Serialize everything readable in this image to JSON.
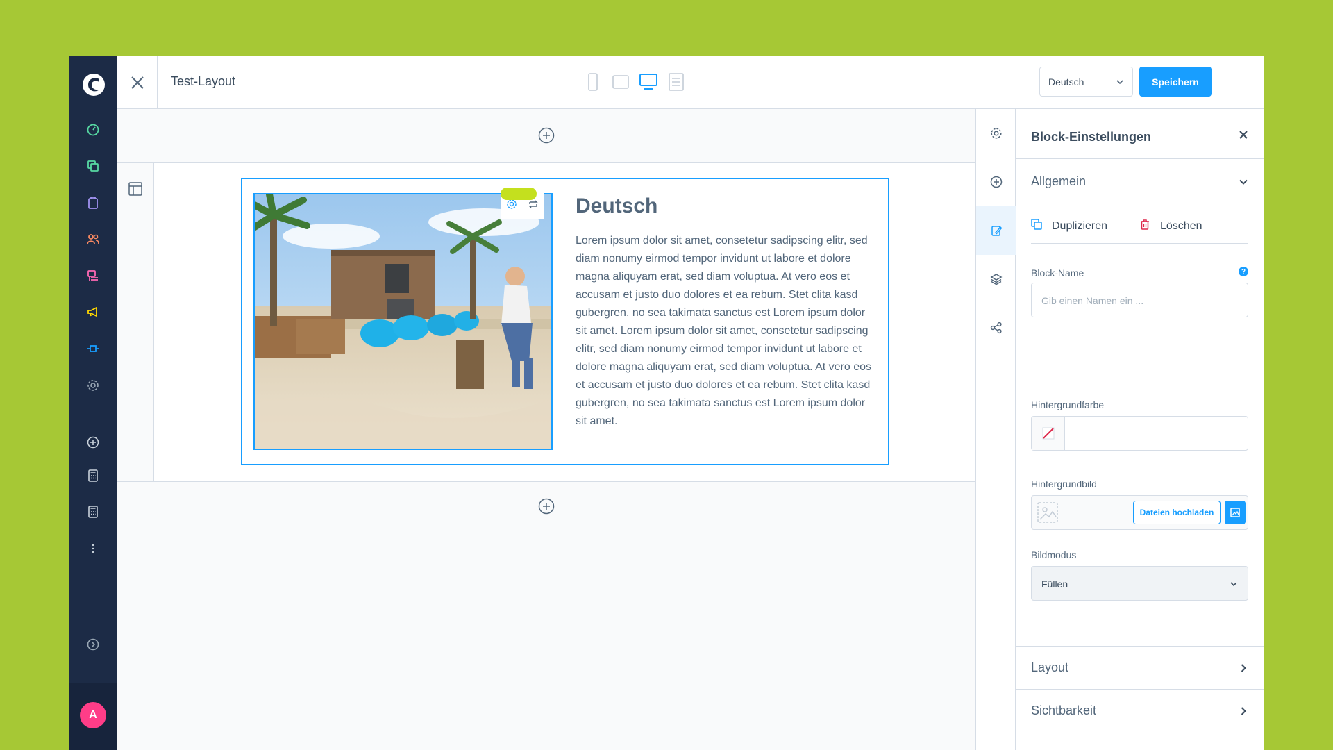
{
  "topbar": {
    "layout_title": "Test-Layout",
    "language": "Deutsch",
    "save_label": "Speichern"
  },
  "block": {
    "heading": "Deutsch",
    "text": "Lorem ipsum dolor sit amet, consetetur sadipscing elitr, sed diam nonumy eirmod tempor invidunt ut labore et dolore magna aliquyam erat, sed diam voluptua. At vero eos et accusam et justo duo dolores et ea rebum. Stet clita kasd gubergren, no sea takimata sanctus est Lorem ipsum dolor sit amet. Lorem ipsum dolor sit amet, consetetur sadipscing elitr, sed diam nonumy eirmod tempor invidunt ut labore et dolore magna aliquyam erat, sed diam voluptua. At vero eos et accusam et justo duo dolores et ea rebum. Stet clita kasd gubergren, no sea takimata sanctus est Lorem ipsum dolor sit amet."
  },
  "panel": {
    "title": "Block-Einstellungen",
    "general_title": "Allgemein",
    "duplicate_label": "Duplizieren",
    "delete_label": "Löschen",
    "block_name_label": "Block-Name",
    "block_name_placeholder": "Gib einen Namen ein ...",
    "bg_color_label": "Hintergrundfarbe",
    "bg_image_label": "Hintergrundbild",
    "upload_label": "Dateien hochladen",
    "image_mode_label": "Bildmodus",
    "image_mode_value": "Füllen",
    "layout_title": "Layout",
    "visibility_title": "Sichtbarkeit"
  },
  "user": {
    "avatar_initial": "A"
  },
  "colors": {
    "page_background": "#a6c835",
    "admin_menu": "#1c2b46",
    "accent": "#189eff",
    "avatar": "#ff3d88"
  },
  "icons": {
    "admin_menu": [
      "dashboard-icon",
      "catalogue-icon",
      "orders-icon",
      "customers-icon",
      "content-icon",
      "marketing-icon",
      "extensions-icon",
      "settings-icon",
      "add-icon",
      "calculator-icon",
      "calculator-icon",
      "more-icon",
      "expand-icon"
    ],
    "rail": [
      "settings-icon",
      "add-icon",
      "edit-icon",
      "layers-icon",
      "share-icon"
    ],
    "devices": [
      "mobile-icon",
      "tablet-icon",
      "desktop-icon",
      "list-view-icon"
    ]
  }
}
